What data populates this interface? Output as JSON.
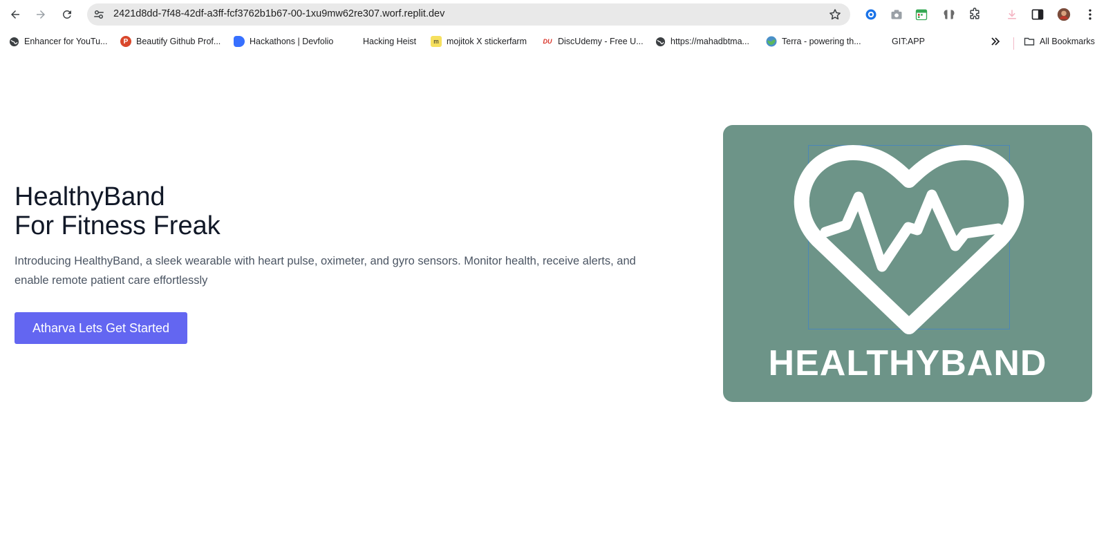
{
  "browser": {
    "url": "2421d8dd-7f48-42df-a3ff-fcf3762b1b67-00-1xu9mw62re307.worf.replit.dev",
    "icons": {
      "back": "arrow-left-icon",
      "forward": "arrow-right-icon",
      "reload": "reload-icon",
      "site_info": "tune-icon",
      "bookmark": "star-icon"
    },
    "extensions": [
      "circle-dot-icon",
      "camera-icon",
      "calendar-icon",
      "brain-icon",
      "puzzle-icon",
      "download-icon",
      "side-panel-icon",
      "avatar",
      "kebab-menu-icon"
    ]
  },
  "bookmarks": {
    "items": [
      {
        "label": "Enhancer for YouTu...",
        "icon": "globe-icon"
      },
      {
        "label": "Beautify Github Prof...",
        "icon": "p-logo-icon"
      },
      {
        "label": "Hackathons | Devfolio",
        "icon": "devfolio-icon"
      },
      {
        "label": "Hacking Heist",
        "icon": ""
      },
      {
        "label": "mojitok X stickerfarm",
        "icon": "mojitok-icon"
      },
      {
        "label": "DiscUdemy - Free U...",
        "icon": "discudemy-icon"
      },
      {
        "label": "https://mahadbtma...",
        "icon": "globe-icon"
      },
      {
        "label": "Terra - powering th...",
        "icon": "terra-icon"
      },
      {
        "label": "GIT:APP",
        "icon": ""
      }
    ],
    "overflow_icon": "chevron-double-right-icon",
    "all_bookmarks": "All Bookmarks"
  },
  "hero": {
    "title_line1": "HealthyBand",
    "title_line2": "For Fitness Freak",
    "description": "Introducing HealthyBand, a sleek wearable with heart pulse, oximeter, and gyro sensors. Monitor health, receive alerts, and enable remote patient care effortlessly",
    "cta_label": "Atharva Lets Get Started",
    "brand_text": "HEALTHYBAND"
  },
  "colors": {
    "accent": "#6366f1",
    "card_bg": "#6d9488",
    "title": "#111827",
    "body_text": "#4b5563"
  }
}
